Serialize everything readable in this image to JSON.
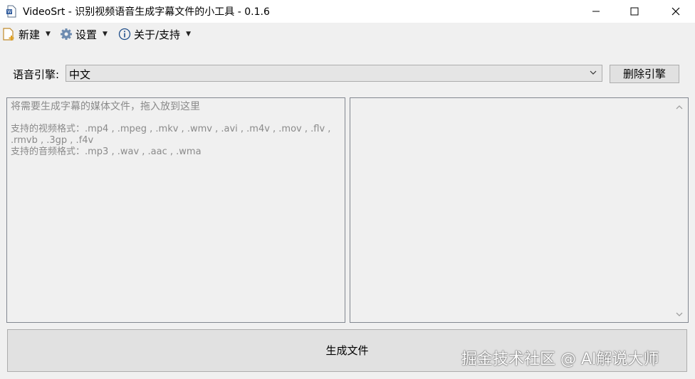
{
  "window": {
    "title": "VideoSrt - 识别视频语音生成字幕文件的小工具 - 0.1.6",
    "app_icon": "document-icon",
    "controls": [
      "minimize-icon",
      "maximize-icon",
      "close-icon"
    ]
  },
  "menu": {
    "new_label": "新建",
    "settings_label": "设置",
    "about_label": "关于/支持"
  },
  "engine": {
    "label": "语音引擎:",
    "selected": "中文",
    "delete_label": "删除引擎"
  },
  "drop_panel": {
    "hint_title": "将需要生成字幕的媒体文件，拖入放到这里",
    "video_formats_line1": "支持的视频格式：.mp4 , .mpeg , .mkv , .wmv , .avi , .m4v , .mov , .flv ,",
    "video_formats_line2": ".rmvb , .3gp , .f4v",
    "audio_formats": "支持的音频格式：.mp3 , .wav , .aac , .wma"
  },
  "generate_label": "生成文件",
  "watermark": "掘金技术社区 @ AI解说大师",
  "colors": {
    "background": "#f0f0f0",
    "titlebar": "#ffffff",
    "border": "#828790",
    "button": "#e1e1e1",
    "hint_text": "#8a8a8a"
  }
}
